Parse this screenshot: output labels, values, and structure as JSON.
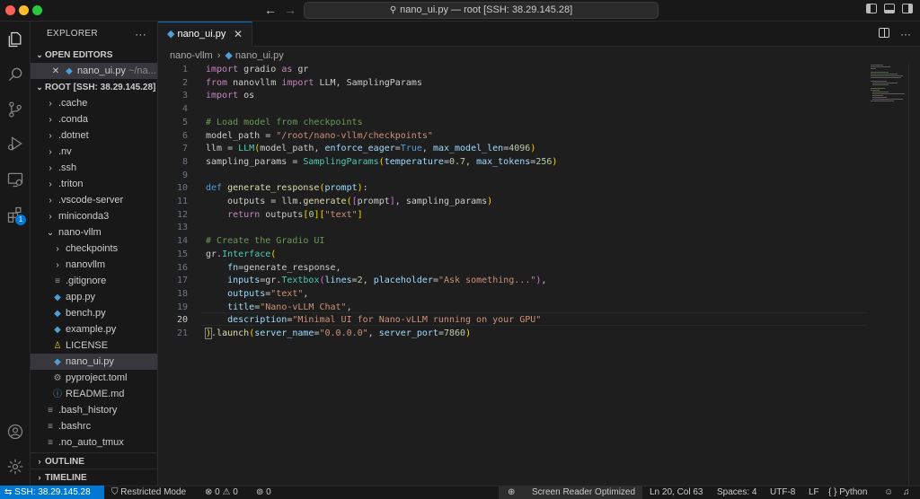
{
  "titlebar": {
    "title": "nano_ui.py — root [SSH: 38.29.145.28]"
  },
  "activity": {
    "extensions_badge": "1"
  },
  "sidebar": {
    "header": "EXPLORER",
    "more": "···",
    "open_editors_title": "OPEN EDITORS",
    "open_editor": {
      "name": "nano_ui.py",
      "path": "~/na..."
    },
    "root_title": "ROOT [SSH: 38.29.145.28]",
    "tree": [
      {
        "label": ".cache",
        "kind": "folder"
      },
      {
        "label": ".conda",
        "kind": "folder"
      },
      {
        "label": ".dotnet",
        "kind": "folder"
      },
      {
        "label": ".nv",
        "kind": "folder"
      },
      {
        "label": ".ssh",
        "kind": "folder"
      },
      {
        "label": ".triton",
        "kind": "folder"
      },
      {
        "label": ".vscode-server",
        "kind": "folder"
      },
      {
        "label": "miniconda3",
        "kind": "folder"
      },
      {
        "label": "nano-vllm",
        "kind": "folder-open"
      },
      {
        "label": "checkpoints",
        "kind": "folder"
      },
      {
        "label": "nanovllm",
        "kind": "folder"
      },
      {
        "label": ".gitignore",
        "kind": "lines"
      },
      {
        "label": "app.py",
        "kind": "py"
      },
      {
        "label": "bench.py",
        "kind": "py"
      },
      {
        "label": "example.py",
        "kind": "py"
      },
      {
        "label": "LICENSE",
        "kind": "license"
      },
      {
        "label": "nano_ui.py",
        "kind": "py"
      },
      {
        "label": "pyproject.toml",
        "kind": "gear"
      },
      {
        "label": "README.md",
        "kind": "info"
      },
      {
        "label": ".bash_history",
        "kind": "lines"
      },
      {
        "label": ".bashrc",
        "kind": "lines"
      },
      {
        "label": ".no_auto_tmux",
        "kind": "lines"
      }
    ],
    "outline_title": "OUTLINE",
    "timeline_title": "TIMELINE"
  },
  "editor": {
    "tab_label": "nano_ui.py",
    "breadcrumb": [
      "nano-vllm",
      "nano_ui.py"
    ],
    "active_line": 20,
    "line_numbers": [
      "1",
      "2",
      "3",
      "4",
      "5",
      "6",
      "7",
      "8",
      "9",
      "10",
      "11",
      "12",
      "13",
      "14",
      "15",
      "16",
      "17",
      "18",
      "19",
      "20",
      "21"
    ],
    "code": {
      "l1": [
        "import",
        "gradio",
        "as",
        "gr"
      ],
      "l2": [
        "from",
        "nanovllm",
        "import",
        "LLM, SamplingParams"
      ],
      "l3": [
        "import",
        "os"
      ],
      "l5": "# Load model from checkpoints",
      "l6": [
        "model_path",
        "\"/root/nano-vllm/checkpoints\""
      ],
      "l7": [
        "llm",
        "LLM",
        "model_path",
        "enforce_eager",
        "True",
        "max_model_len",
        "4096"
      ],
      "l8": [
        "sampling_params",
        "SamplingParams",
        "temperature",
        "0.7",
        "max_tokens",
        "256"
      ],
      "l10": [
        "def",
        "generate_response",
        "prompt"
      ],
      "l11": [
        "outputs",
        "llm",
        "generate",
        "prompt",
        "sampling_params"
      ],
      "l12": [
        "return",
        "outputs",
        "0",
        "\"text\""
      ],
      "l14": "# Create the Gradio UI",
      "l15": [
        "gr",
        "Interface"
      ],
      "l16": [
        "fn",
        "generate_response"
      ],
      "l17": [
        "inputs",
        "gr",
        "Textbox",
        "lines",
        "2",
        "placeholder",
        "\"Ask something...\""
      ],
      "l18": [
        "outputs",
        "\"text\""
      ],
      "l19": [
        "title",
        "\"Nano-vLLM Chat\""
      ],
      "l20": [
        "description",
        "\"Minimal UI for Nano-vLLM running on your GPU\""
      ],
      "l21": [
        "launch",
        "server_name",
        "\"0.0.0.0\"",
        "server_port",
        "7860"
      ]
    }
  },
  "status": {
    "remote": "SSH: 38.29.145.28",
    "restricted": "Restricted Mode",
    "problems": "⊗ 0 ⚠ 0",
    "ports": "0",
    "screen_reader": "Screen Reader Optimized",
    "position": "Ln 20, Col 63",
    "spaces": "Spaces: 4",
    "encoding": "UTF-8",
    "eol": "LF",
    "language": "Python"
  },
  "colors": {
    "accent": "#0078d4",
    "keyword": "#c586c0",
    "string": "#ce9178",
    "comment": "#6a9955"
  }
}
